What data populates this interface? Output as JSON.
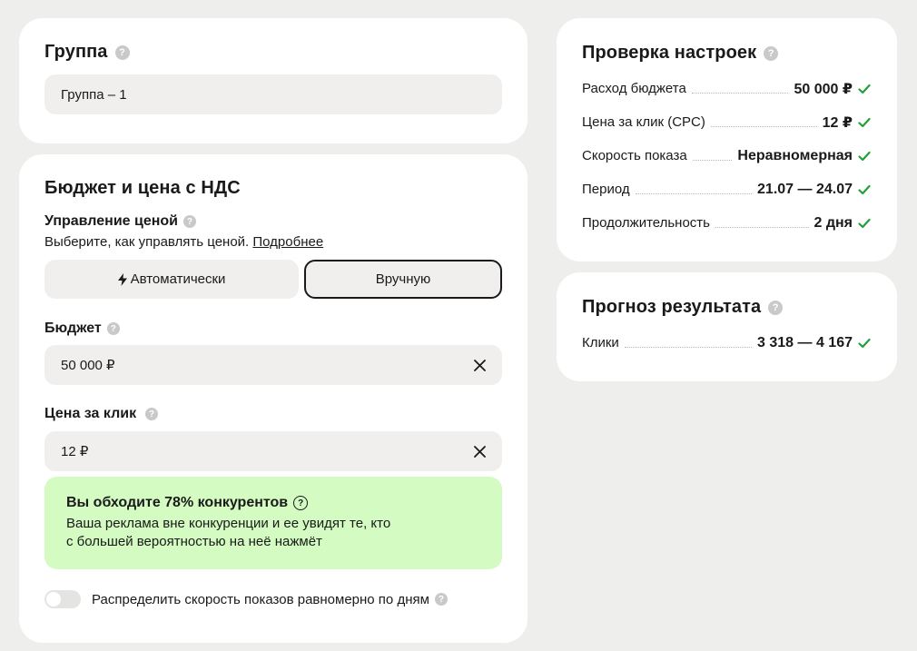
{
  "group": {
    "title": "Группа",
    "name_value": "Группа – 1"
  },
  "budget_section": {
    "title": "Бюджет и цена с НДС",
    "price_control": {
      "label": "Управление ценой",
      "hint": "Выберите, как управлять ценой.",
      "more_link": "Подробнее",
      "options": [
        "Автоматически",
        "Вручную"
      ],
      "selected": "Вручную"
    },
    "budget": {
      "label": "Бюджет",
      "value": "50 000 ₽"
    },
    "cpc": {
      "label": "Цена за клик",
      "value": "12 ₽"
    },
    "promo": {
      "title": "Вы обходите 78% конкурентов",
      "line1": "Ваша реклама вне конкуренции и ее увидят те, кто",
      "line2": "с большей вероятностью на неё нажмёт"
    },
    "toggle": {
      "label": "Распределить скорость показов равномерно по дням",
      "on": false
    }
  },
  "check": {
    "title": "Проверка настроек",
    "rows": [
      {
        "key": "Расход бюджета",
        "value": "50 000 ₽"
      },
      {
        "key": "Цена за клик (CPC)",
        "value": "12 ₽"
      },
      {
        "key": "Скорость показа",
        "value": "Неравномерная"
      },
      {
        "key": "Период",
        "value": "21.07 — 24.07"
      },
      {
        "key": "Продолжительность",
        "value": "2 дня"
      }
    ]
  },
  "forecast": {
    "title": "Прогноз результата",
    "rows": [
      {
        "key": "Клики",
        "value": "3 318 — 4 167"
      }
    ]
  },
  "colors": {
    "check_green": "#21a038",
    "promo_bg": "#d3fbc2",
    "field_bg": "#f0efed"
  },
  "icons": [
    "help-icon",
    "lightning-icon",
    "close-icon",
    "check-icon",
    "question-circle-icon"
  ]
}
